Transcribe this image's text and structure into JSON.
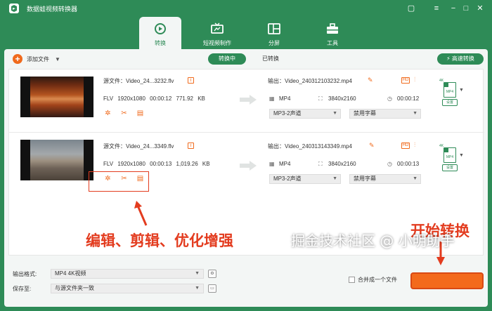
{
  "app": {
    "title": "数据蛙视频转换器"
  },
  "window_controls": [
    "chat-icon",
    "menu-icon",
    "minimize-icon",
    "maximize-icon",
    "close-icon"
  ],
  "tabs": [
    {
      "label": "转换",
      "icon": "convert-icon",
      "active": true
    },
    {
      "label": "短视频制作",
      "icon": "tv-icon",
      "active": false
    },
    {
      "label": "分屏",
      "icon": "split-screen-icon",
      "active": false
    },
    {
      "label": "工具",
      "icon": "toolbox-icon",
      "active": false
    }
  ],
  "toolbar": {
    "add_file": "添加文件",
    "converting": "转换中",
    "converted": "已转换",
    "fast_convert": "高速转换"
  },
  "files": [
    {
      "source": "源文件：Video_24...3232.flv",
      "format": "FLV",
      "resolution": "1920x1080",
      "duration": "00:00:12",
      "size": "771.92 KB",
      "output": "输出：Video_240312103232.mp4",
      "out_format": "MP4",
      "out_resolution": "3840x2160",
      "out_duration": "00:00:12",
      "audio": "MP3-2声道",
      "subtitle": "禁用字幕",
      "format_badge": "4K",
      "format_file": "MP4",
      "format_setting": "设置"
    },
    {
      "source": "源文件：Video_24...3349.flv",
      "format": "FLV",
      "resolution": "1920x1080",
      "duration": "00:00:13",
      "size": "1,019.26 KB",
      "output": "输出：Video_240313143349.mp4",
      "out_format": "MP4",
      "out_resolution": "3840x2160",
      "out_duration": "00:00:13",
      "audio": "MP3-2声道",
      "subtitle": "禁用字幕",
      "format_badge": "4K",
      "format_file": "MP4",
      "format_setting": "设置"
    }
  ],
  "annotations": {
    "edit_tools": "编辑、剪辑、优化增强",
    "start_convert": "开始转换"
  },
  "bottom": {
    "output_format_label": "输出格式:",
    "output_format_value": "MP4 4K视频",
    "save_to_label": "保存至:",
    "save_to_value": "与源文件夹一致",
    "merge_label": "合并成一个文件"
  },
  "watermark": "掘金技术社区 @ 小明助手",
  "colors": {
    "brand": "#2e8b57",
    "accent": "#f06a1c",
    "annotation": "#e33c1f"
  }
}
